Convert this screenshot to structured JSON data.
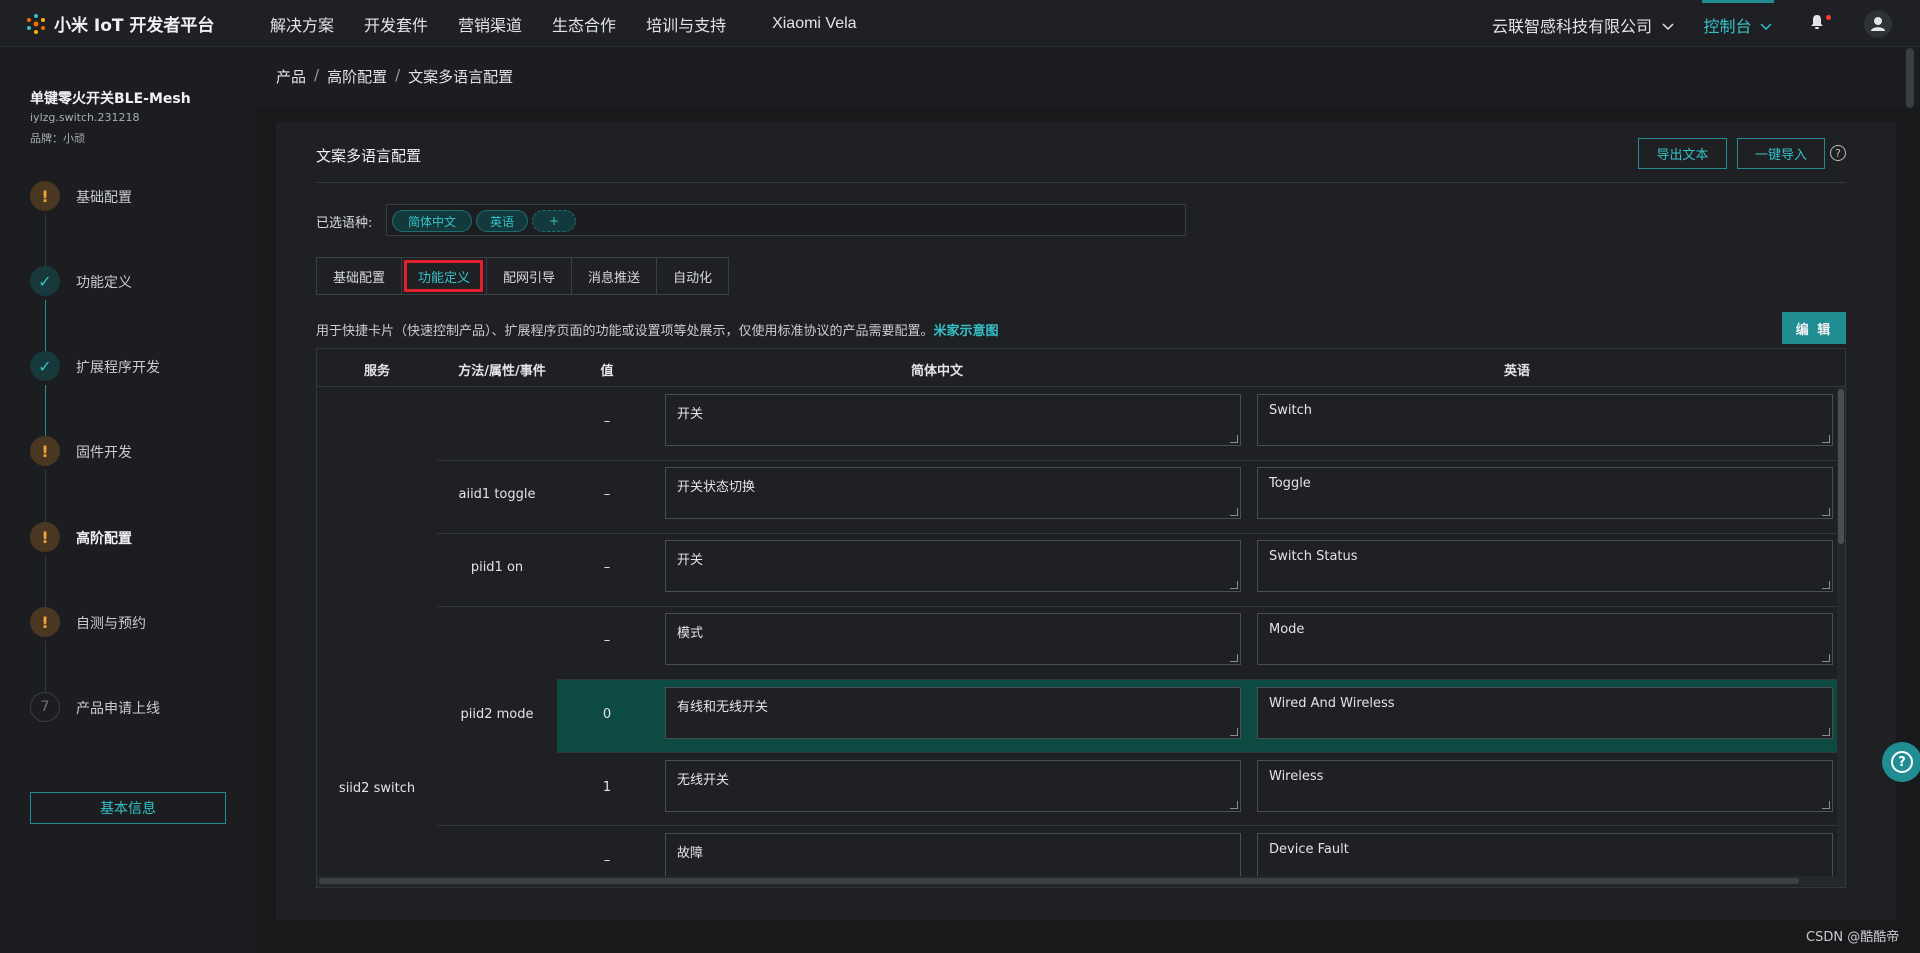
{
  "header": {
    "logo_text": "小米 IoT 开发者平台",
    "nav": [
      "解决方案",
      "开发套件",
      "营销渠道",
      "生态合作",
      "培训与支持",
      "Xiaomi Vela"
    ],
    "company": "云联智感科技有限公司",
    "console": "控制台"
  },
  "sidebar": {
    "product_name": "单键零火开关BLE-Mesh",
    "product_model": "iylzg.switch.231218",
    "brand": "品牌：小顽",
    "steps": [
      {
        "label": "基础配置",
        "state": "warn",
        "mark": "!"
      },
      {
        "label": "功能定义",
        "state": "done",
        "mark": "✓"
      },
      {
        "label": "扩展程序开发",
        "state": "done",
        "mark": "✓"
      },
      {
        "label": "固件开发",
        "state": "warn",
        "mark": "!"
      },
      {
        "label": "高阶配置",
        "state": "warn",
        "mark": "!"
      },
      {
        "label": "自测与预约",
        "state": "warn",
        "mark": "!"
      },
      {
        "label": "产品申请上线",
        "state": "todo",
        "mark": "7"
      }
    ],
    "basic_info_button": "基本信息"
  },
  "breadcrumb": [
    "产品",
    "高阶配置",
    "文案多语言配置"
  ],
  "panel": {
    "title": "文案多语言配置",
    "export_button": "导出文本",
    "import_button": "一键导入",
    "help": "?",
    "lang_label": "已选语种:",
    "languages": [
      "简体中文",
      "英语"
    ],
    "add_lang": "+",
    "tabs": [
      "基础配置",
      "功能定义",
      "配网引导",
      "消息推送",
      "自动化"
    ],
    "active_tab": "功能定义",
    "description": "用于快捷卡片（快速控制产品）、扩展程序页面的功能或设置项等处展示，仅使用标准协议的产品需要配置。",
    "description_link": "米家示意图",
    "edit_button": "编 辑"
  },
  "table": {
    "headers": [
      "服务",
      "方法/属性/事件",
      "值",
      "简体中文",
      "英语"
    ],
    "service": "siid2 switch",
    "rows": [
      {
        "method": "",
        "value": "–",
        "zh": "开关",
        "en": "Switch"
      },
      {
        "method": "aiid1 toggle",
        "value": "–",
        "zh": "开关状态切换",
        "en": "Toggle"
      },
      {
        "method": "piid1 on",
        "value": "–",
        "zh": "开关",
        "en": "Switch Status"
      },
      {
        "method": "",
        "value": "–",
        "zh": "模式",
        "en": "Mode"
      },
      {
        "method": "piid2 mode",
        "value": "0",
        "zh": "有线和无线开关",
        "en": "Wired And Wireless"
      },
      {
        "method": "",
        "value": "1",
        "zh": "无线开关",
        "en": "Wireless"
      },
      {
        "method": "",
        "value": "–",
        "zh": "故障",
        "en": "Device Fault"
      }
    ]
  },
  "watermark": "CSDN @酷酷帝",
  "colors": {
    "accent": "#35c2c7",
    "accent_dark": "#1f8d92",
    "warn": "#f2a33a",
    "highlight_row": "#0d4a41",
    "red_box": "#e0202a"
  }
}
